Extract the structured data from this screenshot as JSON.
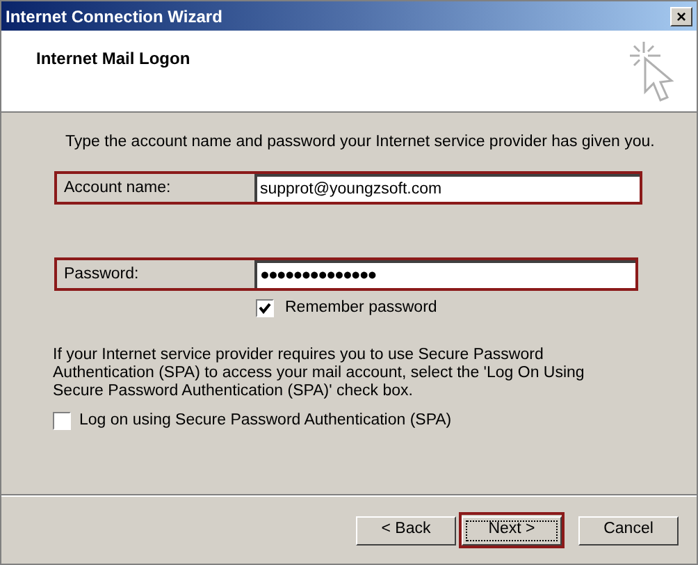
{
  "window": {
    "title": "Internet Connection Wizard",
    "close": "×"
  },
  "header": {
    "title": "Internet Mail Logon"
  },
  "intro": "Type the account name and password your Internet service provider has given you.",
  "fields": [
    {
      "label": "Account name:",
      "value": "supprot@youngzsoft.com",
      "kind": "text",
      "highlighted": true
    },
    {
      "label": "Password:",
      "value": "●●●●●●●●●●●●●●",
      "kind": "password",
      "highlighted": true
    }
  ],
  "remember": {
    "label": "Remember password",
    "checked": true
  },
  "spa_note": "If your Internet service provider requires you to use Secure Password Authentication (SPA) to access your mail account, select the 'Log On Using Secure Password Authentication (SPA)' check box.",
  "spa": {
    "label": "Log on using Secure Password Authentication (SPA)",
    "checked": false
  },
  "buttons": [
    {
      "label": "< Back",
      "highlighted": false
    },
    {
      "label": "Next >",
      "highlighted": true
    },
    {
      "label": "Cancel",
      "highlighted": false
    }
  ]
}
